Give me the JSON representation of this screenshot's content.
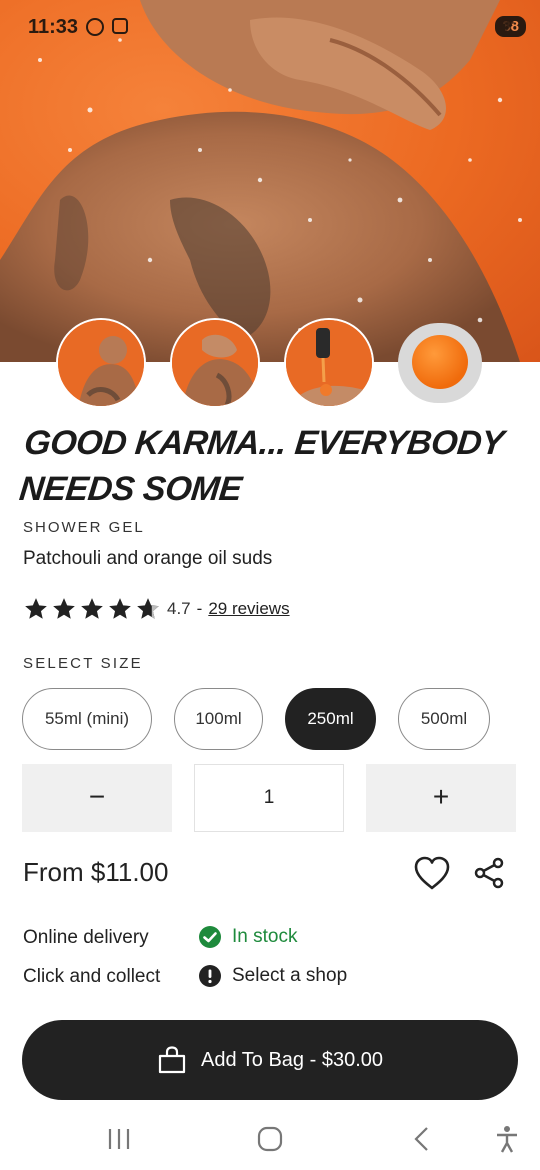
{
  "status_bar": {
    "time": "11:33",
    "battery": "88",
    "icons": [
      "sync-icon",
      "screenshot-icon",
      "wifi-icon",
      "signal-icon",
      "battery-icon"
    ]
  },
  "gallery": {
    "thumbnails": [
      "thumbnail-1",
      "thumbnail-2",
      "thumbnail-3",
      "thumbnail-4"
    ]
  },
  "product": {
    "title": "Good Karma... Everybody Needs Some",
    "category": "SHOWER GEL",
    "subtitle": "Patchouli and orange oil suds",
    "rating": 4.7,
    "rating_text": "4.7",
    "rating_separator": "-",
    "reviews_label": "29 reviews"
  },
  "size": {
    "label": "SELECT SIZE",
    "options": [
      "55ml (mini)",
      "100ml",
      "250ml",
      "500ml"
    ],
    "selected": "250ml"
  },
  "quantity": {
    "minus_label": "−",
    "value": "1",
    "plus_label": "+"
  },
  "price": {
    "label": "From $11.00"
  },
  "availability": {
    "online_label": "Online delivery",
    "online_status": "In stock",
    "collect_label": "Click and collect",
    "collect_status": "Select a shop"
  },
  "cta": {
    "label": "Add To Bag - $30.00"
  },
  "colors": {
    "accent_orange": "#ec6a22",
    "dark": "#222222",
    "in_stock_green": "#1e8a3c"
  }
}
